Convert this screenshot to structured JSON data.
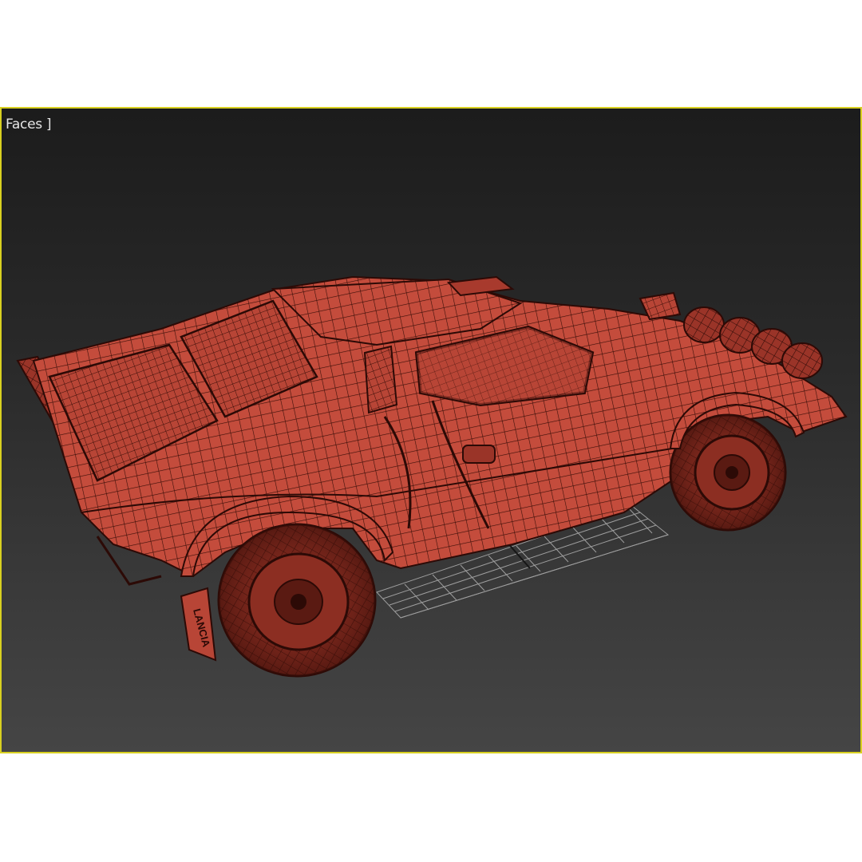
{
  "viewport": {
    "label": "Faces ]",
    "active_border_color": "#d8d020",
    "background_top": "#1c1c1c",
    "background_bottom": "#454545"
  },
  "model": {
    "display_mode": "wireframe-shaded",
    "surface_color": "#c8503f",
    "edge_color": "#3a0e08",
    "plate_text": "LANCIA"
  },
  "grid": {
    "color": "#b0b0b0"
  }
}
